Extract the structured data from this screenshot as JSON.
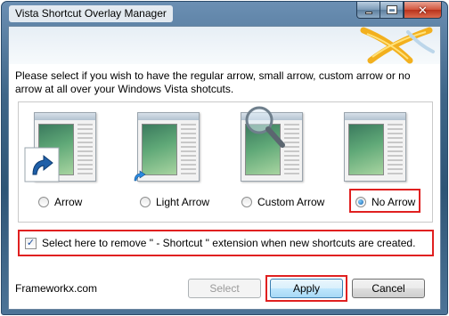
{
  "window": {
    "title": "Vista Shortcut Overlay Manager",
    "accent_color": "#2e5576"
  },
  "titlebar_buttons": {
    "minimize_icon": "minimize-icon",
    "maximize_icon": "maximize-icon",
    "close_icon": "close-icon"
  },
  "header": {
    "logo_icon": "frameworkx-logo-icon"
  },
  "instructions": "Please select if you wish to have the regular arrow, small arrow, custom arrow or no arrow at all over your Windows Vista shotcuts.",
  "options": [
    {
      "label": "Arrow",
      "selected": false,
      "icon": "large-arrow-overlay-icon"
    },
    {
      "label": "Light Arrow",
      "selected": false,
      "icon": "small-arrow-overlay-icon"
    },
    {
      "label": "Custom Arrow",
      "selected": false,
      "icon": "magnifier-overlay-icon"
    },
    {
      "label": "No Arrow",
      "selected": true,
      "icon": ""
    }
  ],
  "remove_extension": {
    "label": "Select here to remove \" - Shortcut \" extension when new shortcuts are created.",
    "checked": true
  },
  "footer": {
    "brand": "Frameworkx.com"
  },
  "buttons": {
    "select": "Select",
    "apply": "Apply",
    "cancel": "Cancel"
  },
  "highlight_color": "#e02020"
}
